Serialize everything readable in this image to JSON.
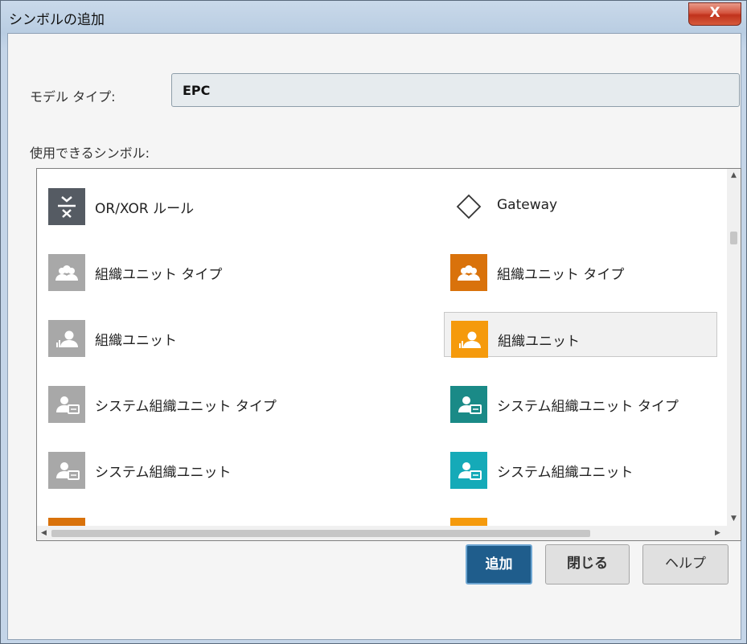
{
  "window": {
    "title": "シンボルの追加",
    "close_label": "X"
  },
  "model_type": {
    "label": "モデル タイプ:",
    "value": "EPC"
  },
  "symbols": {
    "label": "使用できるシンボル:",
    "items": [
      {
        "label": "OR/XOR ルール",
        "icon": "or-xor-rule-icon",
        "color": "#555b63"
      },
      {
        "label": "Gateway",
        "icon": "gateway-diamond-icon",
        "color": "#ffffff"
      },
      {
        "label": "組織ユニット タイプ",
        "icon": "org-unit-type-icon",
        "color": "#a8a8a8"
      },
      {
        "label": "組織ユニット タイプ",
        "icon": "org-unit-type-icon",
        "color": "#d9720b"
      },
      {
        "label": "組織ユニット",
        "icon": "org-unit-icon",
        "color": "#a8a8a8"
      },
      {
        "label": "組織ユニット",
        "icon": "org-unit-icon",
        "color": "#f59a0c"
      },
      {
        "label": "システム組織ユニット タイプ",
        "icon": "system-org-unit-type-icon",
        "color": "#a8a8a8"
      },
      {
        "label": "システム組織ユニット タイプ",
        "icon": "system-org-unit-type-icon",
        "color": "#1a8a87"
      },
      {
        "label": "システム組織ユニット",
        "icon": "system-org-unit-icon",
        "color": "#a8a8a8"
      },
      {
        "label": "システム組織ユニット",
        "icon": "system-org-unit-icon",
        "color": "#15aab8"
      }
    ],
    "partial_colors": [
      "#d9720b",
      "#f59a0c"
    ],
    "selected_index": 5
  },
  "buttons": {
    "add": "追加",
    "close": "閉じる",
    "help": "ヘルプ"
  }
}
